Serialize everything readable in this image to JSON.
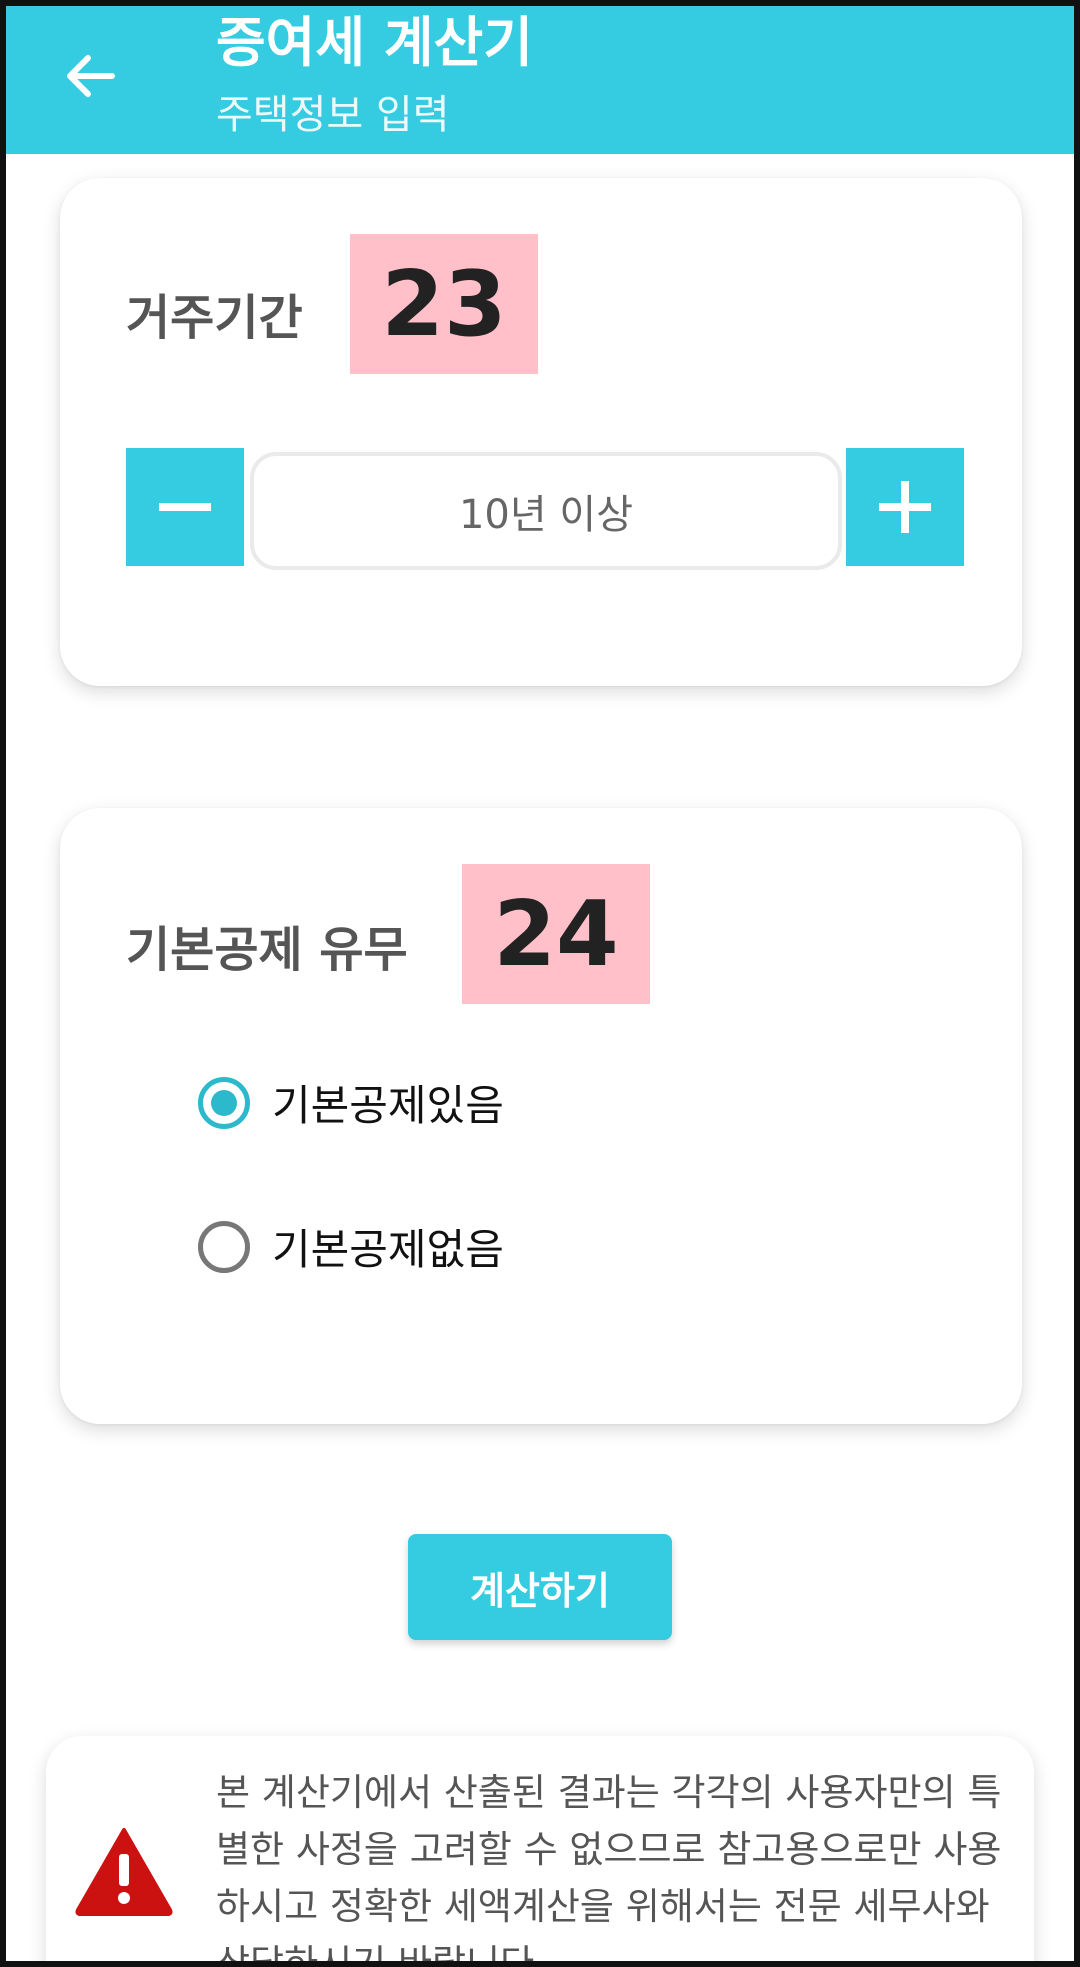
{
  "appbar": {
    "title": "증여세 계산기",
    "subtitle": "주택정보 입력",
    "back_icon": "arrow-left-icon",
    "color": "#35cbe0"
  },
  "residence": {
    "label": "거주기간",
    "badge": "23",
    "value": "10년 이상",
    "decrement_icon": "minus-icon",
    "increment_icon": "plus-icon"
  },
  "deduction": {
    "label": "기본공제 유무",
    "badge": "24",
    "options": [
      {
        "label": "기본공제있음",
        "selected": true
      },
      {
        "label": "기본공제없음",
        "selected": false
      }
    ]
  },
  "actions": {
    "calculate_label": "계산하기"
  },
  "notice": {
    "icon": "warning-icon",
    "text": "본 계산기에서 산출된 결과는 각각의 사용자만의 특별한 사정을 고려할 수 없으므로 참고용으로만 사용하시고 정확한 세액계산을 위해서는 전문 세무사와 상담하시기 바랍니다."
  },
  "colors": {
    "accent": "#35cbe0",
    "badge": "#ffc0c9",
    "radio_checked": "#2db9cc",
    "warning": "#cc1111"
  }
}
